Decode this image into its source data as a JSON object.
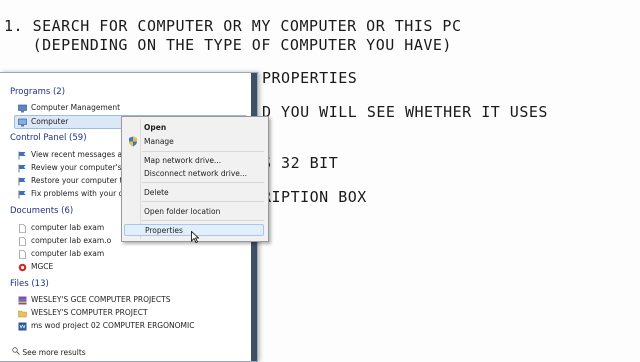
{
  "slide": {
    "line1": "1. SEARCH FOR COMPUTER OR MY COMPUTER OR THIS PC",
    "line1b": "   (DEPENDING ON THE TYPE OF COMPUTER YOU HAVE)",
    "line2": "PROPERTIES",
    "line3": "D YOU WILL SEE WHETHER IT USES",
    "line4": "S 32 BIT",
    "line5": "RIPTION BOX"
  },
  "start_menu": {
    "programs_header": "Programs (2)",
    "programs": [
      "Computer Management",
      "Computer"
    ],
    "control_panel_header": "Control Panel (59)",
    "control_panel": [
      "View recent messages about",
      "Review your computer's stat",
      "Restore your computer to a",
      "Fix problems with your com"
    ],
    "documents_header": "Documents (6)",
    "documents": [
      "computer lab exam",
      "computer lab exam.o",
      "computer lab exam",
      "MGCE"
    ],
    "files_header": "Files (13)",
    "files": [
      "WESLEY'S GCE COMPUTER PROJECTS",
      "WESLEY'S COMPUTER PROJECT",
      "ms wod project 02 COMPUTER ERGONOMIC"
    ],
    "see_more": "See more results"
  },
  "context_menu": {
    "open": "Open",
    "manage": "Manage",
    "map_network_drive": "Map network drive...",
    "disconnect_network_drive": "Disconnect network drive...",
    "delete": "Delete",
    "open_folder_location": "Open folder location",
    "properties": "Properties"
  },
  "colors": {
    "header_blue": "#1e3287",
    "selection": "#dbe8f8"
  }
}
